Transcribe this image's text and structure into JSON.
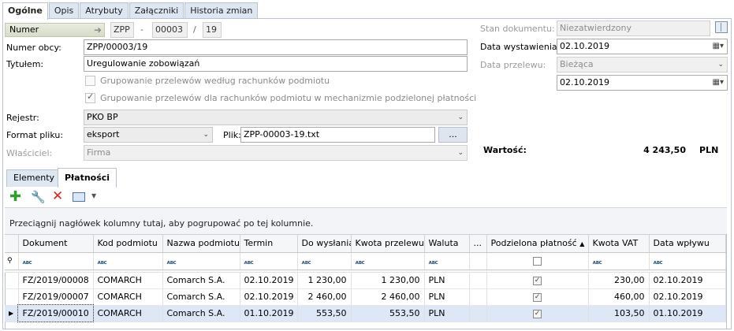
{
  "tabs": [
    "Ogólne",
    "Opis",
    "Atrybuty",
    "Załączniki",
    "Historia zmian"
  ],
  "numer": {
    "label": "Numer",
    "prefix": "ZPP",
    "sep1": "-",
    "num": "00003",
    "sep2": "/",
    "year": "19"
  },
  "numer_obcy": {
    "label": "Numer obcy:",
    "value": "ZPP/00003/19"
  },
  "tytulem": {
    "label": "Tytułem:",
    "value": "Uregulowanie zobowiązań"
  },
  "checks": {
    "group1": {
      "label": "Grupowanie przelewów według rachunków podmiotu",
      "checked": false
    },
    "group2": {
      "label": "Grupowanie przelewów dla rachunków podmiotu w mechanizmie podzielonej płatności",
      "checked": true
    }
  },
  "rejestr": {
    "label": "Rejestr:",
    "value": "PKO BP"
  },
  "format": {
    "label": "Format pliku:",
    "value": "eksport"
  },
  "plik": {
    "label": "Plik:",
    "value": "ZPP-00003-19.txt",
    "button": "..."
  },
  "wlasciciel": {
    "label": "Właściciel:",
    "value": "Firma"
  },
  "stan": {
    "label": "Stan dokumentu:",
    "value": "Niezatwierdzony"
  },
  "data_wyst": {
    "label": "Data wystawienia:",
    "value": "02.10.2019"
  },
  "data_przelewu": {
    "label": "Data przelewu:",
    "value": "Bieżąca"
  },
  "data_extra": {
    "value": "02.10.2019"
  },
  "wartosc": {
    "label": "Wartość:",
    "value": "4 243,50",
    "currency": "PLN"
  },
  "subtabs": [
    "Elementy",
    "Płatności"
  ],
  "grid": {
    "group_hint": "Przeciągnij nagłówek kolumny tutaj, aby pogrupować po tej kolumnie.",
    "filter_icon": "abc-filter-icon",
    "columns": [
      "Dokument",
      "Kod podmiotu",
      "Nazwa podmiotu",
      "Termin",
      "Do wysłania",
      "Kwota przelewu",
      "Waluta",
      "...",
      "Podzielona płatność",
      "Kwota VAT",
      "Data wpływu"
    ],
    "rows": [
      {
        "dokument": "FZ/2019/00008",
        "kod": "COMARCH",
        "nazwa": "Comarch S.A.",
        "termin": "02.10.2019",
        "do_wyslania": "1 230,00",
        "kwota": "1 230,00",
        "waluta": "PLN",
        "podzielona": true,
        "vat": "230,00",
        "data_wplywu": "02.10.2019"
      },
      {
        "dokument": "FZ/2019/00007",
        "kod": "COMARCH",
        "nazwa": "Comarch S.A.",
        "termin": "02.10.2019",
        "do_wyslania": "2 460,00",
        "kwota": "2 460,00",
        "waluta": "PLN",
        "podzielona": true,
        "vat": "460,00",
        "data_wplywu": "02.10.2019"
      },
      {
        "dokument": "FZ/2019/00010",
        "kod": "COMARCH",
        "nazwa": "Comarch S.A.",
        "termin": "01.10.2019",
        "do_wyslania": "553,50",
        "kwota": "553,50",
        "waluta": "PLN",
        "podzielona": true,
        "vat": "103,50",
        "data_wplywu": "01.10.2019"
      }
    ]
  },
  "colors": {
    "accent": "#dde6f1",
    "border": "#b7c3d3",
    "selected_row": "#dde7f5"
  }
}
